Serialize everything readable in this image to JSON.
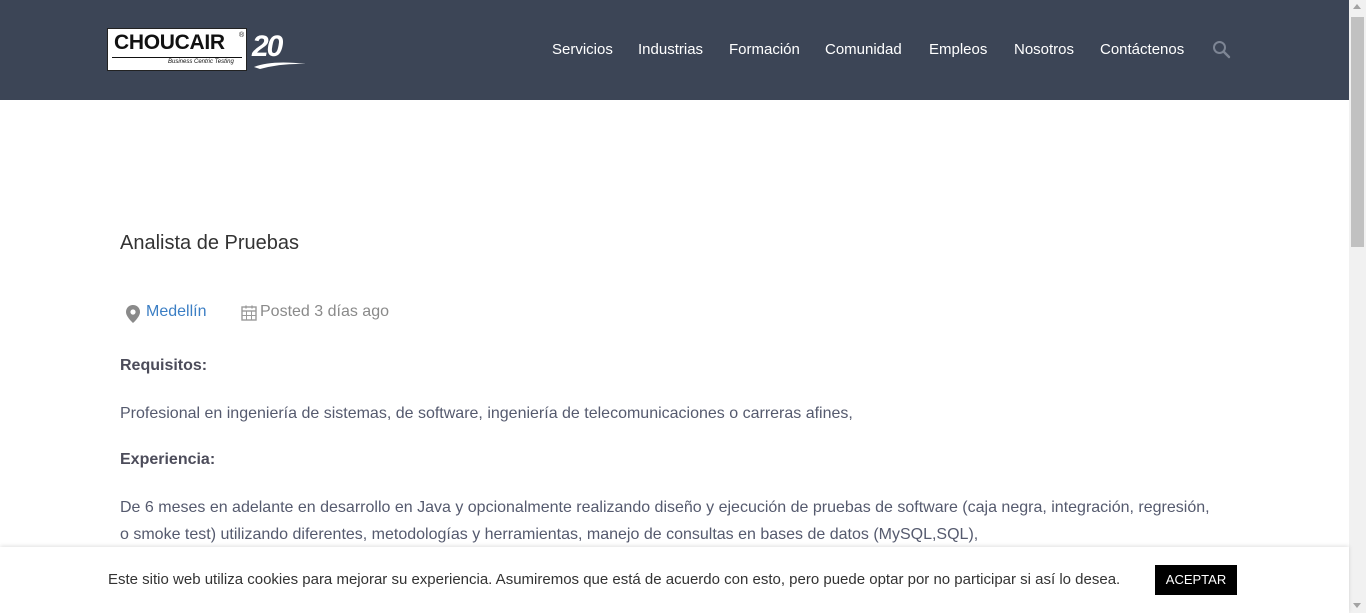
{
  "header": {
    "logo_text": "CHOUCAIR",
    "logo_tagline": "Business Centric Testing",
    "logo_anniversary": "20",
    "nav": [
      {
        "label": "Servicios"
      },
      {
        "label": "Industrias"
      },
      {
        "label": "Formación"
      },
      {
        "label": "Comunidad"
      },
      {
        "label": "Empleos"
      },
      {
        "label": "Nosotros"
      },
      {
        "label": "Contáctenos"
      }
    ],
    "search_icon": "search-icon",
    "background_color": "#3c4556"
  },
  "job": {
    "title": "Analista de Pruebas",
    "location": "Medellín",
    "posted": "Posted 3 días ago",
    "sections": [
      {
        "heading": "Requisitos:",
        "text": "Profesional en ingeniería de sistemas, de software, ingeniería de telecomunicaciones o carreras afines,"
      },
      {
        "heading": "Experiencia:",
        "text": "De 6 meses en adelante en desarrollo en Java y opcionalmente realizando diseño y ejecución de pruebas de software (caja negra, integración, regresión, o smoke test) utilizando diferentes, metodologías y herramientas, manejo de consultas en bases de datos (MySQL,SQL),"
      }
    ],
    "link_color": "#3b7ec4"
  },
  "cookie": {
    "text": "Este sitio web utiliza cookies para mejorar su experiencia. Asumiremos que está de acuerdo con esto, pero puede optar por no participar si así lo desea.",
    "accept_label": "ACEPTAR"
  }
}
